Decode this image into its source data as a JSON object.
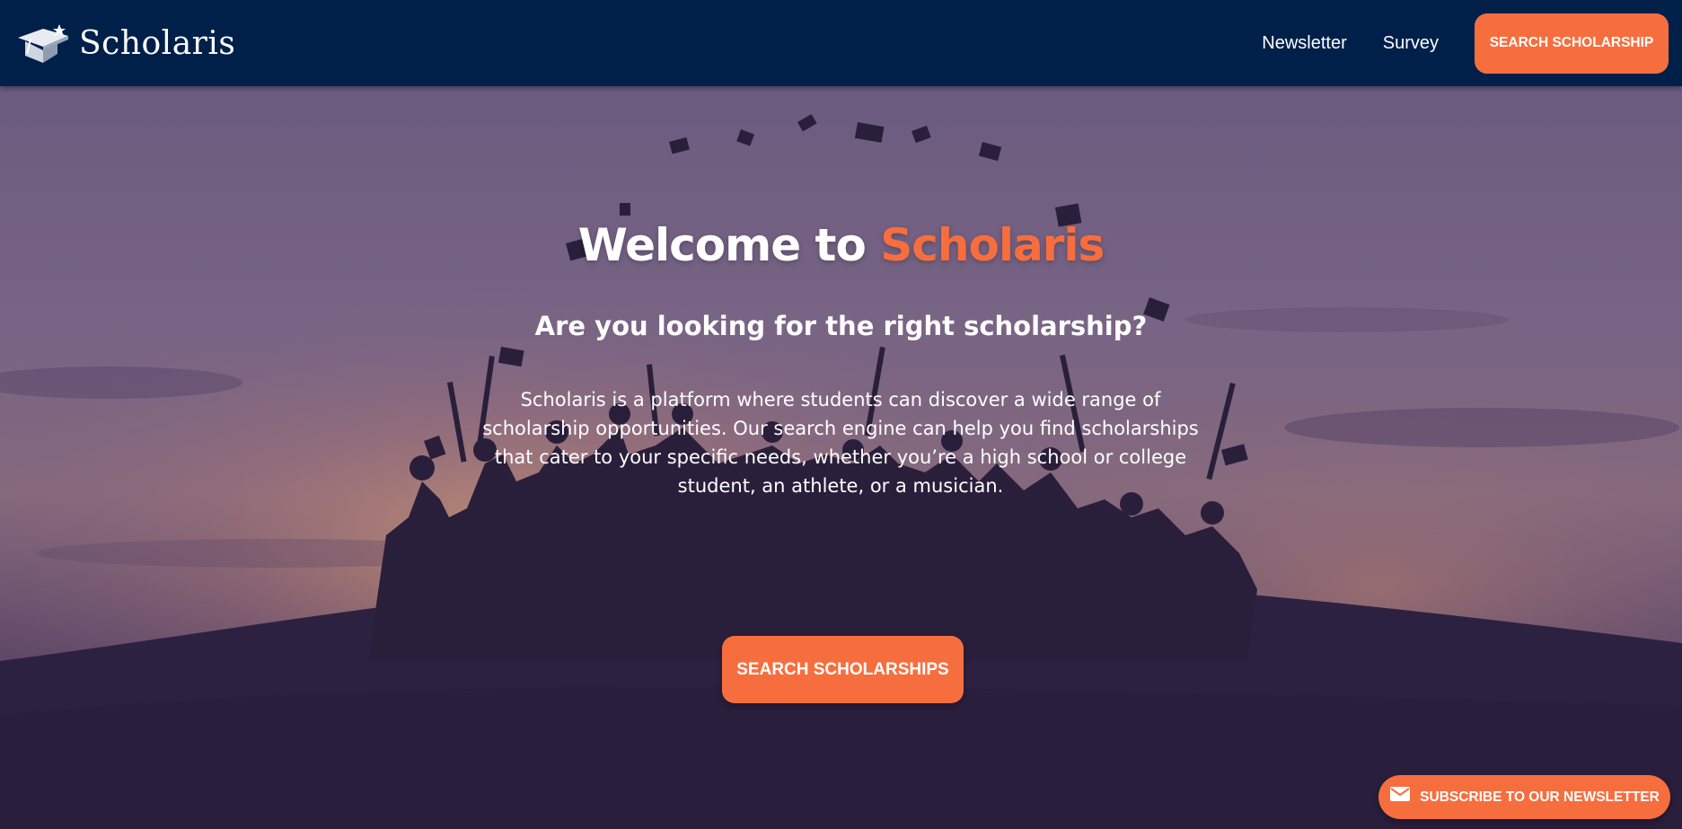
{
  "header": {
    "brand_name": "Scholaris",
    "logo_icon": "graduation-cap-star-icon",
    "nav": [
      {
        "label": "Newsletter"
      },
      {
        "label": "Survey"
      }
    ],
    "cta_label": "SEARCH SCHOLARSHIP"
  },
  "hero": {
    "title_prefix": "Welcome to ",
    "title_accent": "Scholaris",
    "subtitle": "Are you looking for the right scholarship?",
    "description": "Scholaris is a platform where students can discover a wide range of scholarship opportunities. Our search engine can help you find scholarships that cater to your specific needs, whether you’re a high school or college student, an athlete, or a musician.",
    "cta_label": "SEARCH SCHOLARSHIPS",
    "background_icon": "graduates-throwing-caps-sunset-image"
  },
  "newsletter_fab": {
    "icon": "mail-icon",
    "label": "SUBSCRIBE TO OUR NEWSLETTER"
  },
  "colors": {
    "navbar_bg": "#00204a",
    "accent": "#f76e3e",
    "text": "#ffffff"
  }
}
